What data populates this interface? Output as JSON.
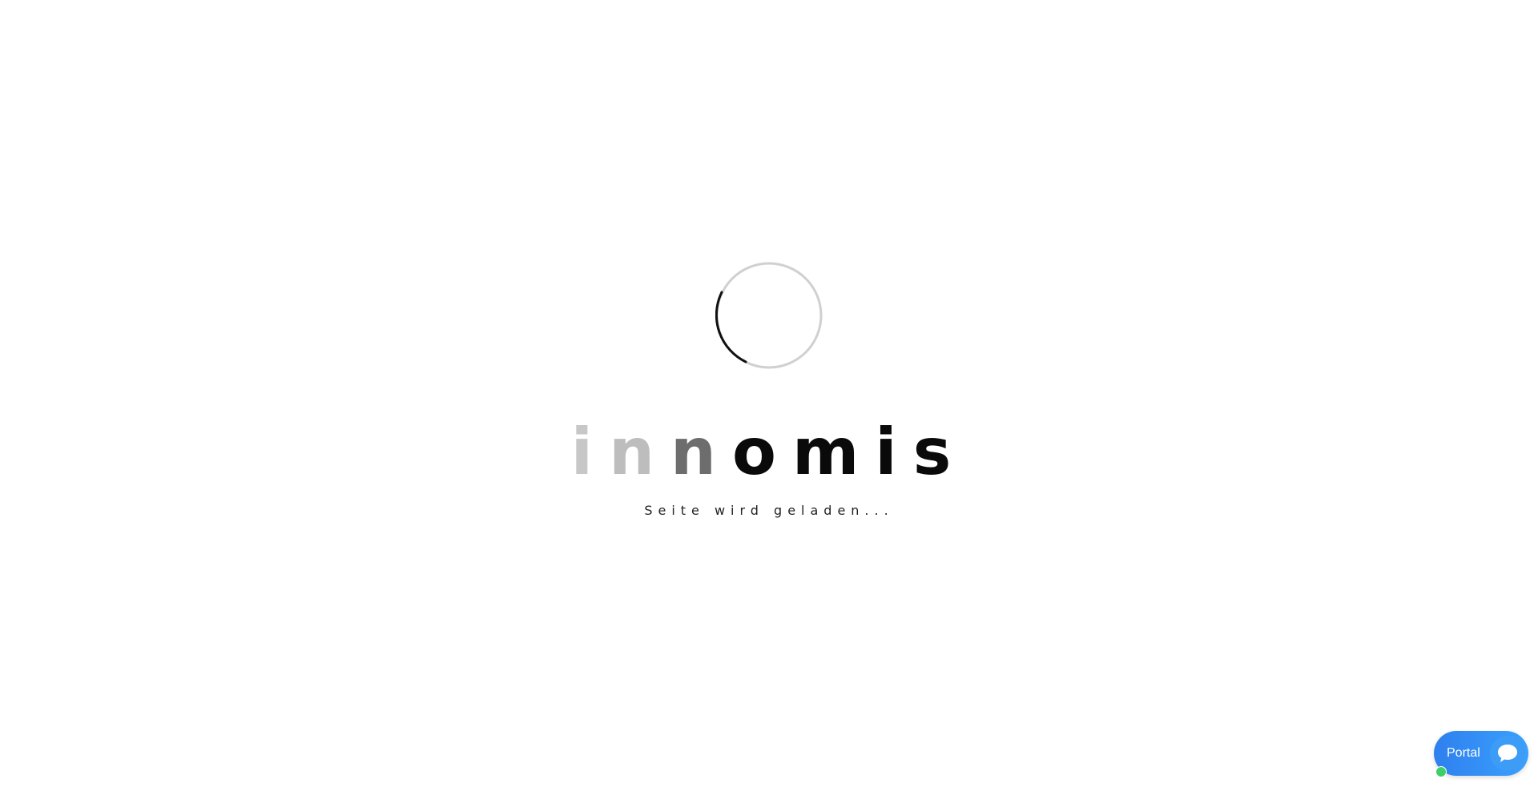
{
  "loader": {
    "brand_letters": [
      "i",
      "n",
      "n",
      "o",
      "m",
      "i",
      "s"
    ],
    "subtitle": "Seite wird geladen..."
  },
  "spinner": {
    "icon": "loading-spinner-icon",
    "track_color": "#d0d0d0",
    "arc_color": "#111111"
  },
  "chat_widget": {
    "label": "Portal",
    "icon": "chat-bubble-icon",
    "status_icon": "online-status-dot",
    "accent_color": "#2f80ed",
    "status_color": "#3ecf6a"
  }
}
